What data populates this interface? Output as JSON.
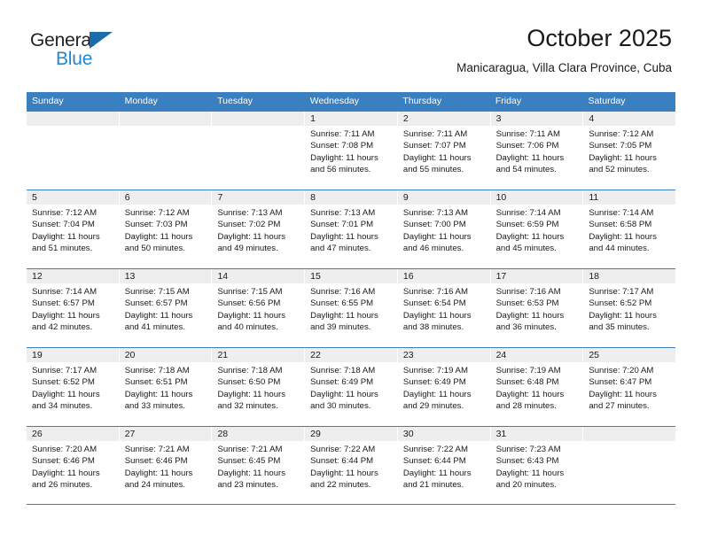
{
  "brand": {
    "name_part1": "General",
    "name_part2": "Blue",
    "triangle_icon": "triangle-icon",
    "color_dark": "#231f20",
    "color_blue": "#2387ce",
    "color_triangle": "#1b6cab"
  },
  "header": {
    "title": "October 2025",
    "subtitle": "Manicaragua, Villa Clara Province, Cuba"
  },
  "theme": {
    "header_blue": "#3a7fbf",
    "daynum_gray": "#eeeeee",
    "text": "#1a1a1a",
    "background": "#ffffff"
  },
  "calendar": {
    "weekday_headers": [
      "Sunday",
      "Monday",
      "Tuesday",
      "Wednesday",
      "Thursday",
      "Friday",
      "Saturday"
    ],
    "weeks": [
      [
        {
          "day": "",
          "empty": true,
          "sunrise": "",
          "sunset": "",
          "daylight1": "",
          "daylight2": ""
        },
        {
          "day": "",
          "empty": true,
          "sunrise": "",
          "sunset": "",
          "daylight1": "",
          "daylight2": ""
        },
        {
          "day": "",
          "empty": true,
          "sunrise": "",
          "sunset": "",
          "daylight1": "",
          "daylight2": ""
        },
        {
          "day": "1",
          "empty": false,
          "sunrise": "Sunrise: 7:11 AM",
          "sunset": "Sunset: 7:08 PM",
          "daylight1": "Daylight: 11 hours",
          "daylight2": "and 56 minutes."
        },
        {
          "day": "2",
          "empty": false,
          "sunrise": "Sunrise: 7:11 AM",
          "sunset": "Sunset: 7:07 PM",
          "daylight1": "Daylight: 11 hours",
          "daylight2": "and 55 minutes."
        },
        {
          "day": "3",
          "empty": false,
          "sunrise": "Sunrise: 7:11 AM",
          "sunset": "Sunset: 7:06 PM",
          "daylight1": "Daylight: 11 hours",
          "daylight2": "and 54 minutes."
        },
        {
          "day": "4",
          "empty": false,
          "sunrise": "Sunrise: 7:12 AM",
          "sunset": "Sunset: 7:05 PM",
          "daylight1": "Daylight: 11 hours",
          "daylight2": "and 52 minutes."
        }
      ],
      [
        {
          "day": "5",
          "empty": false,
          "sunrise": "Sunrise: 7:12 AM",
          "sunset": "Sunset: 7:04 PM",
          "daylight1": "Daylight: 11 hours",
          "daylight2": "and 51 minutes."
        },
        {
          "day": "6",
          "empty": false,
          "sunrise": "Sunrise: 7:12 AM",
          "sunset": "Sunset: 7:03 PM",
          "daylight1": "Daylight: 11 hours",
          "daylight2": "and 50 minutes."
        },
        {
          "day": "7",
          "empty": false,
          "sunrise": "Sunrise: 7:13 AM",
          "sunset": "Sunset: 7:02 PM",
          "daylight1": "Daylight: 11 hours",
          "daylight2": "and 49 minutes."
        },
        {
          "day": "8",
          "empty": false,
          "sunrise": "Sunrise: 7:13 AM",
          "sunset": "Sunset: 7:01 PM",
          "daylight1": "Daylight: 11 hours",
          "daylight2": "and 47 minutes."
        },
        {
          "day": "9",
          "empty": false,
          "sunrise": "Sunrise: 7:13 AM",
          "sunset": "Sunset: 7:00 PM",
          "daylight1": "Daylight: 11 hours",
          "daylight2": "and 46 minutes."
        },
        {
          "day": "10",
          "empty": false,
          "sunrise": "Sunrise: 7:14 AM",
          "sunset": "Sunset: 6:59 PM",
          "daylight1": "Daylight: 11 hours",
          "daylight2": "and 45 minutes."
        },
        {
          "day": "11",
          "empty": false,
          "sunrise": "Sunrise: 7:14 AM",
          "sunset": "Sunset: 6:58 PM",
          "daylight1": "Daylight: 11 hours",
          "daylight2": "and 44 minutes."
        }
      ],
      [
        {
          "day": "12",
          "empty": false,
          "sunrise": "Sunrise: 7:14 AM",
          "sunset": "Sunset: 6:57 PM",
          "daylight1": "Daylight: 11 hours",
          "daylight2": "and 42 minutes."
        },
        {
          "day": "13",
          "empty": false,
          "sunrise": "Sunrise: 7:15 AM",
          "sunset": "Sunset: 6:57 PM",
          "daylight1": "Daylight: 11 hours",
          "daylight2": "and 41 minutes."
        },
        {
          "day": "14",
          "empty": false,
          "sunrise": "Sunrise: 7:15 AM",
          "sunset": "Sunset: 6:56 PM",
          "daylight1": "Daylight: 11 hours",
          "daylight2": "and 40 minutes."
        },
        {
          "day": "15",
          "empty": false,
          "sunrise": "Sunrise: 7:16 AM",
          "sunset": "Sunset: 6:55 PM",
          "daylight1": "Daylight: 11 hours",
          "daylight2": "and 39 minutes."
        },
        {
          "day": "16",
          "empty": false,
          "sunrise": "Sunrise: 7:16 AM",
          "sunset": "Sunset: 6:54 PM",
          "daylight1": "Daylight: 11 hours",
          "daylight2": "and 38 minutes."
        },
        {
          "day": "17",
          "empty": false,
          "sunrise": "Sunrise: 7:16 AM",
          "sunset": "Sunset: 6:53 PM",
          "daylight1": "Daylight: 11 hours",
          "daylight2": "and 36 minutes."
        },
        {
          "day": "18",
          "empty": false,
          "sunrise": "Sunrise: 7:17 AM",
          "sunset": "Sunset: 6:52 PM",
          "daylight1": "Daylight: 11 hours",
          "daylight2": "and 35 minutes."
        }
      ],
      [
        {
          "day": "19",
          "empty": false,
          "sunrise": "Sunrise: 7:17 AM",
          "sunset": "Sunset: 6:52 PM",
          "daylight1": "Daylight: 11 hours",
          "daylight2": "and 34 minutes."
        },
        {
          "day": "20",
          "empty": false,
          "sunrise": "Sunrise: 7:18 AM",
          "sunset": "Sunset: 6:51 PM",
          "daylight1": "Daylight: 11 hours",
          "daylight2": "and 33 minutes."
        },
        {
          "day": "21",
          "empty": false,
          "sunrise": "Sunrise: 7:18 AM",
          "sunset": "Sunset: 6:50 PM",
          "daylight1": "Daylight: 11 hours",
          "daylight2": "and 32 minutes."
        },
        {
          "day": "22",
          "empty": false,
          "sunrise": "Sunrise: 7:18 AM",
          "sunset": "Sunset: 6:49 PM",
          "daylight1": "Daylight: 11 hours",
          "daylight2": "and 30 minutes."
        },
        {
          "day": "23",
          "empty": false,
          "sunrise": "Sunrise: 7:19 AM",
          "sunset": "Sunset: 6:49 PM",
          "daylight1": "Daylight: 11 hours",
          "daylight2": "and 29 minutes."
        },
        {
          "day": "24",
          "empty": false,
          "sunrise": "Sunrise: 7:19 AM",
          "sunset": "Sunset: 6:48 PM",
          "daylight1": "Daylight: 11 hours",
          "daylight2": "and 28 minutes."
        },
        {
          "day": "25",
          "empty": false,
          "sunrise": "Sunrise: 7:20 AM",
          "sunset": "Sunset: 6:47 PM",
          "daylight1": "Daylight: 11 hours",
          "daylight2": "and 27 minutes."
        }
      ],
      [
        {
          "day": "26",
          "empty": false,
          "sunrise": "Sunrise: 7:20 AM",
          "sunset": "Sunset: 6:46 PM",
          "daylight1": "Daylight: 11 hours",
          "daylight2": "and 26 minutes."
        },
        {
          "day": "27",
          "empty": false,
          "sunrise": "Sunrise: 7:21 AM",
          "sunset": "Sunset: 6:46 PM",
          "daylight1": "Daylight: 11 hours",
          "daylight2": "and 24 minutes."
        },
        {
          "day": "28",
          "empty": false,
          "sunrise": "Sunrise: 7:21 AM",
          "sunset": "Sunset: 6:45 PM",
          "daylight1": "Daylight: 11 hours",
          "daylight2": "and 23 minutes."
        },
        {
          "day": "29",
          "empty": false,
          "sunrise": "Sunrise: 7:22 AM",
          "sunset": "Sunset: 6:44 PM",
          "daylight1": "Daylight: 11 hours",
          "daylight2": "and 22 minutes."
        },
        {
          "day": "30",
          "empty": false,
          "sunrise": "Sunrise: 7:22 AM",
          "sunset": "Sunset: 6:44 PM",
          "daylight1": "Daylight: 11 hours",
          "daylight2": "and 21 minutes."
        },
        {
          "day": "31",
          "empty": false,
          "sunrise": "Sunrise: 7:23 AM",
          "sunset": "Sunset: 6:43 PM",
          "daylight1": "Daylight: 11 hours",
          "daylight2": "and 20 minutes."
        },
        {
          "day": "",
          "empty": true,
          "sunrise": "",
          "sunset": "",
          "daylight1": "",
          "daylight2": ""
        }
      ]
    ]
  }
}
